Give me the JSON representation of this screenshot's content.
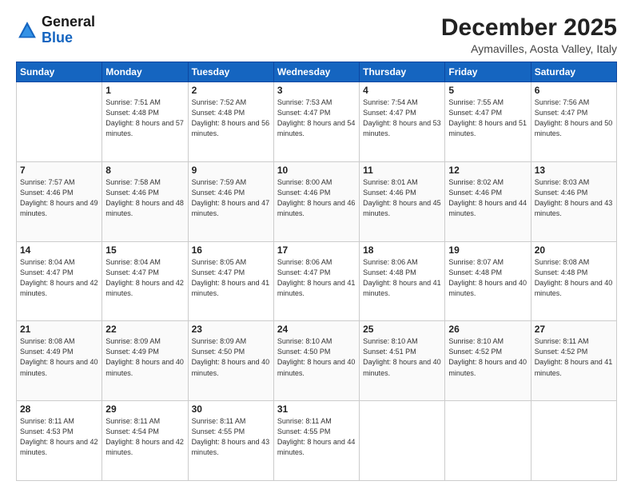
{
  "logo": {
    "line1": "General",
    "line2": "Blue"
  },
  "header": {
    "month": "December 2025",
    "location": "Aymavilles, Aosta Valley, Italy"
  },
  "days_of_week": [
    "Sunday",
    "Monday",
    "Tuesday",
    "Wednesday",
    "Thursday",
    "Friday",
    "Saturday"
  ],
  "weeks": [
    [
      {
        "day": "",
        "sunrise": "",
        "sunset": "",
        "daylight": ""
      },
      {
        "day": "1",
        "sunrise": "Sunrise: 7:51 AM",
        "sunset": "Sunset: 4:48 PM",
        "daylight": "Daylight: 8 hours and 57 minutes."
      },
      {
        "day": "2",
        "sunrise": "Sunrise: 7:52 AM",
        "sunset": "Sunset: 4:48 PM",
        "daylight": "Daylight: 8 hours and 56 minutes."
      },
      {
        "day": "3",
        "sunrise": "Sunrise: 7:53 AM",
        "sunset": "Sunset: 4:47 PM",
        "daylight": "Daylight: 8 hours and 54 minutes."
      },
      {
        "day": "4",
        "sunrise": "Sunrise: 7:54 AM",
        "sunset": "Sunset: 4:47 PM",
        "daylight": "Daylight: 8 hours and 53 minutes."
      },
      {
        "day": "5",
        "sunrise": "Sunrise: 7:55 AM",
        "sunset": "Sunset: 4:47 PM",
        "daylight": "Daylight: 8 hours and 51 minutes."
      },
      {
        "day": "6",
        "sunrise": "Sunrise: 7:56 AM",
        "sunset": "Sunset: 4:47 PM",
        "daylight": "Daylight: 8 hours and 50 minutes."
      }
    ],
    [
      {
        "day": "7",
        "sunrise": "Sunrise: 7:57 AM",
        "sunset": "Sunset: 4:46 PM",
        "daylight": "Daylight: 8 hours and 49 minutes."
      },
      {
        "day": "8",
        "sunrise": "Sunrise: 7:58 AM",
        "sunset": "Sunset: 4:46 PM",
        "daylight": "Daylight: 8 hours and 48 minutes."
      },
      {
        "day": "9",
        "sunrise": "Sunrise: 7:59 AM",
        "sunset": "Sunset: 4:46 PM",
        "daylight": "Daylight: 8 hours and 47 minutes."
      },
      {
        "day": "10",
        "sunrise": "Sunrise: 8:00 AM",
        "sunset": "Sunset: 4:46 PM",
        "daylight": "Daylight: 8 hours and 46 minutes."
      },
      {
        "day": "11",
        "sunrise": "Sunrise: 8:01 AM",
        "sunset": "Sunset: 4:46 PM",
        "daylight": "Daylight: 8 hours and 45 minutes."
      },
      {
        "day": "12",
        "sunrise": "Sunrise: 8:02 AM",
        "sunset": "Sunset: 4:46 PM",
        "daylight": "Daylight: 8 hours and 44 minutes."
      },
      {
        "day": "13",
        "sunrise": "Sunrise: 8:03 AM",
        "sunset": "Sunset: 4:46 PM",
        "daylight": "Daylight: 8 hours and 43 minutes."
      }
    ],
    [
      {
        "day": "14",
        "sunrise": "Sunrise: 8:04 AM",
        "sunset": "Sunset: 4:47 PM",
        "daylight": "Daylight: 8 hours and 42 minutes."
      },
      {
        "day": "15",
        "sunrise": "Sunrise: 8:04 AM",
        "sunset": "Sunset: 4:47 PM",
        "daylight": "Daylight: 8 hours and 42 minutes."
      },
      {
        "day": "16",
        "sunrise": "Sunrise: 8:05 AM",
        "sunset": "Sunset: 4:47 PM",
        "daylight": "Daylight: 8 hours and 41 minutes."
      },
      {
        "day": "17",
        "sunrise": "Sunrise: 8:06 AM",
        "sunset": "Sunset: 4:47 PM",
        "daylight": "Daylight: 8 hours and 41 minutes."
      },
      {
        "day": "18",
        "sunrise": "Sunrise: 8:06 AM",
        "sunset": "Sunset: 4:48 PM",
        "daylight": "Daylight: 8 hours and 41 minutes."
      },
      {
        "day": "19",
        "sunrise": "Sunrise: 8:07 AM",
        "sunset": "Sunset: 4:48 PM",
        "daylight": "Daylight: 8 hours and 40 minutes."
      },
      {
        "day": "20",
        "sunrise": "Sunrise: 8:08 AM",
        "sunset": "Sunset: 4:48 PM",
        "daylight": "Daylight: 8 hours and 40 minutes."
      }
    ],
    [
      {
        "day": "21",
        "sunrise": "Sunrise: 8:08 AM",
        "sunset": "Sunset: 4:49 PM",
        "daylight": "Daylight: 8 hours and 40 minutes."
      },
      {
        "day": "22",
        "sunrise": "Sunrise: 8:09 AM",
        "sunset": "Sunset: 4:49 PM",
        "daylight": "Daylight: 8 hours and 40 minutes."
      },
      {
        "day": "23",
        "sunrise": "Sunrise: 8:09 AM",
        "sunset": "Sunset: 4:50 PM",
        "daylight": "Daylight: 8 hours and 40 minutes."
      },
      {
        "day": "24",
        "sunrise": "Sunrise: 8:10 AM",
        "sunset": "Sunset: 4:50 PM",
        "daylight": "Daylight: 8 hours and 40 minutes."
      },
      {
        "day": "25",
        "sunrise": "Sunrise: 8:10 AM",
        "sunset": "Sunset: 4:51 PM",
        "daylight": "Daylight: 8 hours and 40 minutes."
      },
      {
        "day": "26",
        "sunrise": "Sunrise: 8:10 AM",
        "sunset": "Sunset: 4:52 PM",
        "daylight": "Daylight: 8 hours and 40 minutes."
      },
      {
        "day": "27",
        "sunrise": "Sunrise: 8:11 AM",
        "sunset": "Sunset: 4:52 PM",
        "daylight": "Daylight: 8 hours and 41 minutes."
      }
    ],
    [
      {
        "day": "28",
        "sunrise": "Sunrise: 8:11 AM",
        "sunset": "Sunset: 4:53 PM",
        "daylight": "Daylight: 8 hours and 42 minutes."
      },
      {
        "day": "29",
        "sunrise": "Sunrise: 8:11 AM",
        "sunset": "Sunset: 4:54 PM",
        "daylight": "Daylight: 8 hours and 42 minutes."
      },
      {
        "day": "30",
        "sunrise": "Sunrise: 8:11 AM",
        "sunset": "Sunset: 4:55 PM",
        "daylight": "Daylight: 8 hours and 43 minutes."
      },
      {
        "day": "31",
        "sunrise": "Sunrise: 8:11 AM",
        "sunset": "Sunset: 4:55 PM",
        "daylight": "Daylight: 8 hours and 44 minutes."
      },
      {
        "day": "",
        "sunrise": "",
        "sunset": "",
        "daylight": ""
      },
      {
        "day": "",
        "sunrise": "",
        "sunset": "",
        "daylight": ""
      },
      {
        "day": "",
        "sunrise": "",
        "sunset": "",
        "daylight": ""
      }
    ]
  ]
}
